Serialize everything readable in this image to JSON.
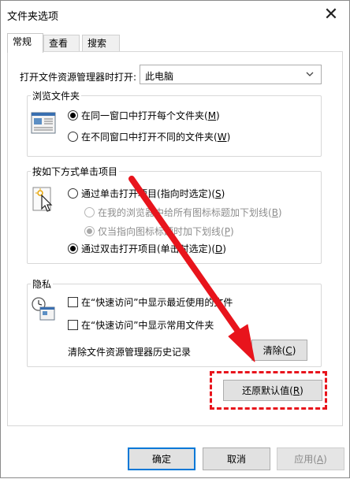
{
  "window": {
    "title": "文件夹选项",
    "close_glyph": "✕"
  },
  "tabs": [
    {
      "label": "常规"
    },
    {
      "label": "查看"
    },
    {
      "label": "搜索"
    }
  ],
  "general": {
    "open_label": "打开文件资源管理器时打开:",
    "open_value": "此电脑",
    "browse": {
      "title": "浏览文件夹",
      "option_same_prefix": "在同一窗口中打开每个文件夹(",
      "option_same_key": "M",
      "option_same_suffix": ")",
      "option_new_prefix": "在不同窗口中打开不同的文件夹(",
      "option_new_key": "W",
      "option_new_suffix": ")"
    },
    "click": {
      "title": "按如下方式单击项目",
      "single_prefix": "通过单击打开项目(指向时选定)(",
      "single_key": "S",
      "single_suffix": ")",
      "underline_all_prefix": "在我的浏览器中给所有图标标题加下划线(",
      "underline_all_key": "B",
      "underline_all_suffix": ")",
      "underline_point_prefix": "仅当指向图标标题时加下划线(",
      "underline_point_key": "P",
      "underline_point_suffix": ")",
      "double_prefix": "通过双击打开项目(单击时选定)(",
      "double_key": "D",
      "double_suffix": ")"
    },
    "privacy": {
      "title": "隐私",
      "recent_files": "在“快速访问”中显示最近使用的文件",
      "frequent_folders": "在“快速访问”中显示常用文件夹",
      "clear_history_label": "清除文件资源管理器历史记录",
      "clear_prefix": "清除(",
      "clear_key": "C",
      "clear_suffix": ")"
    },
    "restore_prefix": "还原默认值(",
    "restore_key": "R",
    "restore_suffix": ")"
  },
  "footer": {
    "ok": "确定",
    "cancel": "取消",
    "apply_prefix": "应用(",
    "apply_key": "A",
    "apply_suffix": ")"
  },
  "annotation": {
    "color": "#e8141c"
  }
}
